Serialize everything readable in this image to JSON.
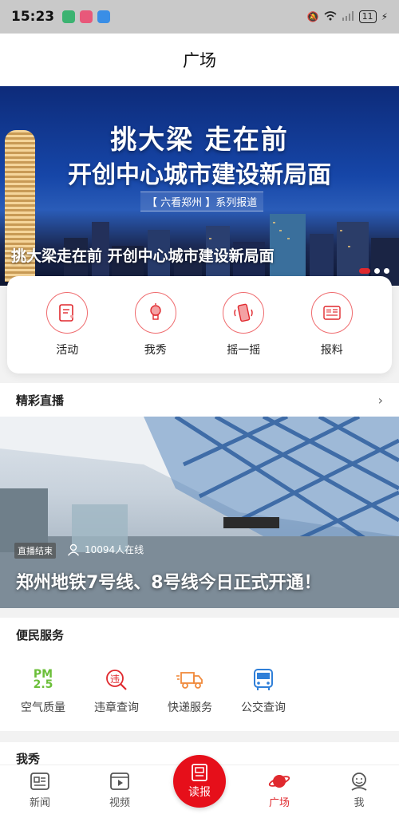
{
  "status_bar": {
    "time": "15:23",
    "battery": "11",
    "app_icons": [
      "notification-app-icon-1",
      "notification-app-icon-2",
      "notification-app-icon-3"
    ]
  },
  "header": {
    "title": "广场"
  },
  "banner": {
    "headline_line1": "挑大梁 走在前",
    "headline_line2": "开创中心城市建设新局面",
    "series_tag": "【 六看郑州 】系列报道",
    "caption": "挑大梁走在前 开创中心城市建设新局面",
    "active_slide": 1,
    "slide_count": 3
  },
  "quick_actions": [
    {
      "label": "活动",
      "icon": "activity-card-icon"
    },
    {
      "label": "我秀",
      "icon": "bulb-icon"
    },
    {
      "label": "摇一摇",
      "icon": "shake-phone-icon"
    },
    {
      "label": "报料",
      "icon": "newspaper-icon"
    }
  ],
  "live_section": {
    "title": "精彩直播",
    "more": "›",
    "status": "直播结束",
    "viewers": "10094人在线",
    "headline": "郑州地铁7号线、8号线今日正式开通！"
  },
  "services_section": {
    "title": "便民服务",
    "items": [
      {
        "label": "空气质量",
        "icon": "pm25-icon",
        "icon_text": [
          "PM",
          "2.5"
        ]
      },
      {
        "label": "违章查询",
        "icon": "violation-search-icon",
        "icon_text": [
          "违"
        ]
      },
      {
        "label": "快递服务",
        "icon": "delivery-truck-icon"
      },
      {
        "label": "公交查询",
        "icon": "bus-icon"
      }
    ]
  },
  "partial_section": {
    "title": "我秀"
  },
  "tab_bar": {
    "items": [
      {
        "label": "新闻",
        "icon": "news-icon"
      },
      {
        "label": "视频",
        "icon": "video-icon"
      },
      {
        "label": "读报",
        "icon": "read-paper-icon"
      },
      {
        "label": "广场",
        "icon": "planet-icon"
      },
      {
        "label": "我",
        "icon": "profile-icon"
      }
    ],
    "active": "广场"
  },
  "colors": {
    "accent": "#e0292e",
    "center_button": "#e60f1a",
    "service_green": "#6cbf3a",
    "service_orange": "#f08a3c",
    "service_blue": "#2f7fd8"
  }
}
